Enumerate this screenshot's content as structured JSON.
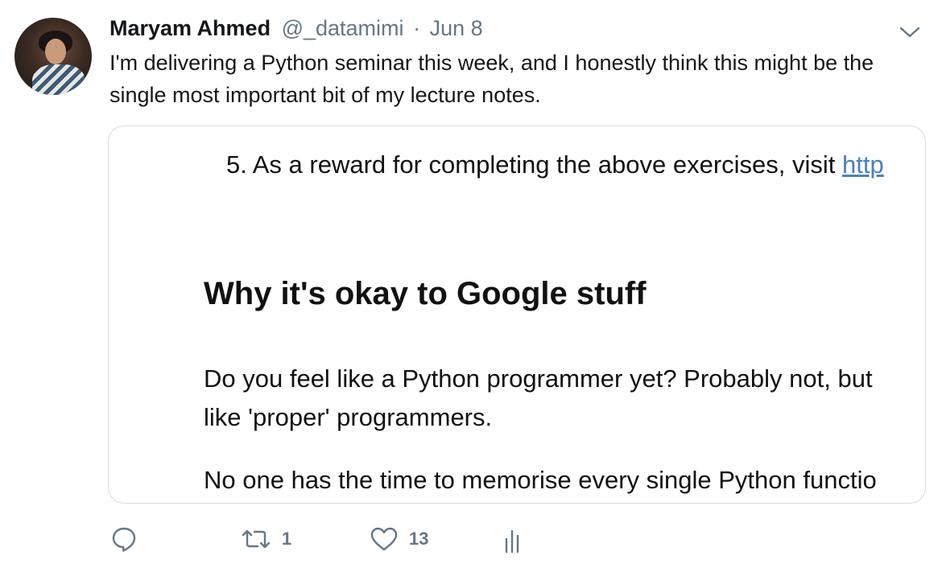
{
  "tweet": {
    "author_name": "Maryam Ahmed",
    "author_handle": "@_datamimi",
    "separator": "·",
    "date": "Jun 8",
    "text": "I'm delivering a Python seminar this week, and I honestly think this might be the single most important bit of my lecture notes."
  },
  "card": {
    "item_prefix": "5. As a reward for completing the above exercises, visit ",
    "item_link": "http",
    "heading": "Why it's okay to Google stuff",
    "para1_line1": "Do you feel like a Python programmer yet? Probably not, but",
    "para1_line2": "like 'proper' programmers.",
    "para2_line1": "No one has the time to memorise every single Python functio"
  },
  "actions": {
    "reply_icon": "reply-icon",
    "retweet_icon": "retweet-icon",
    "retweet_count": "1",
    "like_icon": "heart-icon",
    "like_count": "13",
    "stats_icon": "analytics-icon"
  },
  "colors": {
    "text": "#14171a",
    "secondary": "#657786",
    "link": "#4a7fc1",
    "card_border": "#d6dde3"
  }
}
